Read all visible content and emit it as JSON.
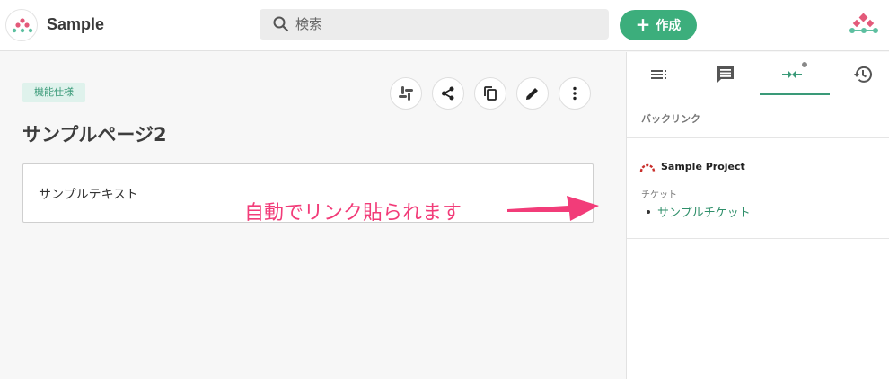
{
  "header": {
    "app_name": "Sample",
    "search_placeholder": "検索",
    "create_label": "作成"
  },
  "main": {
    "tag": "機能仕様",
    "title": "サンプルページ2",
    "content": "サンプルテキスト",
    "actions": [
      "slack-icon",
      "share-icon",
      "copy-icon",
      "edit-icon",
      "more-vert-icon"
    ]
  },
  "annotation": {
    "text": "自動でリンク貼られます",
    "color": "#f23c79"
  },
  "panel": {
    "tabs": [
      "toc-icon",
      "comment-icon",
      "backlink-icon",
      "history-icon"
    ],
    "active_tab": 2,
    "section_label": "バックリンク",
    "project_name": "Sample Project",
    "group_label": "チケット",
    "links": [
      "サンプルチケット"
    ]
  },
  "colors": {
    "accent": "#3cae7c",
    "link": "#2f8f6a"
  }
}
